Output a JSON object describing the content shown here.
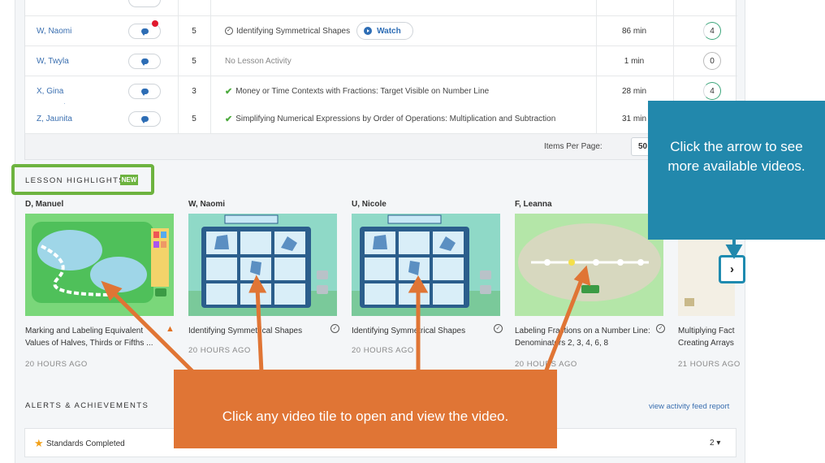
{
  "roster": {
    "rows": [
      {
        "name": "W, Naomi",
        "grade": "5",
        "lesson": "Identifying Symmetrical Shapes",
        "lesson_status": "viewed",
        "watch_label": "Watch",
        "minutes": "86 min",
        "score": "4",
        "has_notification": true
      },
      {
        "name": "W, Twyla",
        "grade": "5",
        "lesson": "No Lesson Activity",
        "lesson_status": "none",
        "minutes": "1 min",
        "score": "0",
        "has_notification": false
      },
      {
        "name": "X, Gina",
        "grade": "3",
        "lesson": "Money or Time Contexts with Fractions: Target Visible on Number Line",
        "lesson_status": "completed",
        "minutes": "28 min",
        "score": "4",
        "has_notification": false
      },
      {
        "name": "Z, Jaunita",
        "grade": "5",
        "lesson": "Simplifying Numerical Expressions by Order of Operations: Multiplication and Subtraction",
        "lesson_status": "completed",
        "minutes": "31 min",
        "score": "",
        "has_notification": false
      }
    ],
    "pager": {
      "label": "Items Per Page:",
      "value": "50"
    }
  },
  "highlights": {
    "title": "LESSON HIGHLIGHTS",
    "badge": "NEW",
    "cards": [
      {
        "student": "D, Manuel",
        "title": "Marking and Labeling Equivalent Values of Halves, Thirds or Fifths ...",
        "time": "20 HOURS AGO",
        "status": "warning"
      },
      {
        "student": "W, Naomi",
        "title": "Identifying Symmetrical Shapes",
        "time": "20 HOURS AGO",
        "status": "done"
      },
      {
        "student": "U, Nicole",
        "title": "Identifying Symmetrical Shapes",
        "time": "20 HOURS AGO",
        "status": "done"
      },
      {
        "student": "F, Leanna",
        "title": "Labeling Fractions on a Number Line: Denominators 2, 3, 4, 6, 8",
        "time": "20 HOURS AGO",
        "status": "done"
      },
      {
        "student": "",
        "title": "Multiplying Fact Creating Arrays",
        "time": "21 HOURS AGO",
        "status": ""
      }
    ],
    "next_arrow": "›"
  },
  "alerts": {
    "title": "ALERTS & ACHIEVEMENTS",
    "feed_link": "view activity feed report",
    "standards_label": "Standards Completed",
    "standards_count": "2"
  },
  "callouts": {
    "orange": "Click any video tile to open and view the video.",
    "blue": "Click the arrow to see more available videos."
  },
  "colors": {
    "callout_orange": "#e07535",
    "callout_blue": "#2288ac",
    "highlight_green": "#6db33f",
    "link_blue": "#3a6fb0"
  }
}
